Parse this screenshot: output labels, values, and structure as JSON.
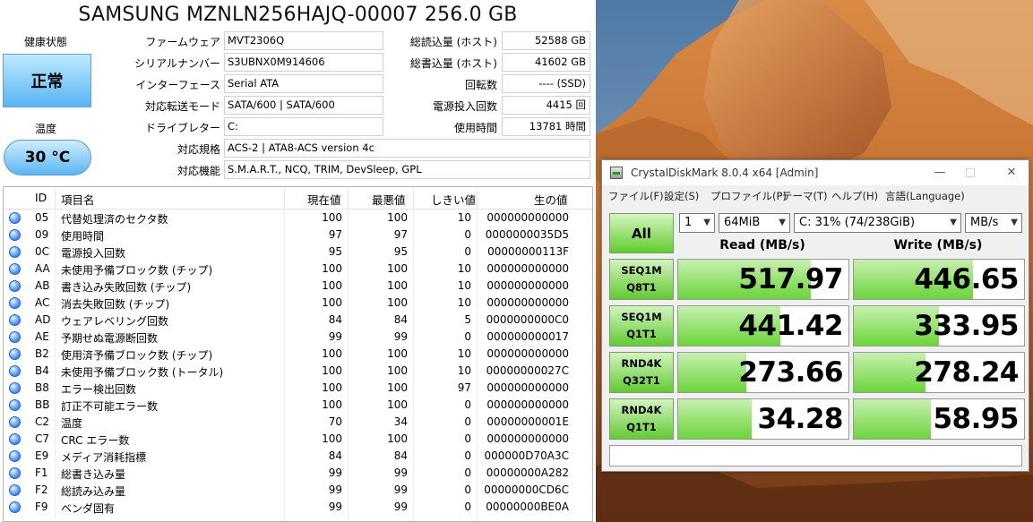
{
  "cdi": {
    "title": "SAMSUNG MZNLN256HAJQ-00007 256.0 GB",
    "health_label": "健康状態",
    "health_value": "正常",
    "temp_label": "温度",
    "temp_value": "30 °C",
    "info_left": [
      {
        "label": "ファームウェア",
        "value": "MVT2306Q"
      },
      {
        "label": "シリアルナンバー",
        "value": "S3UBNX0M914606"
      },
      {
        "label": "インターフェース",
        "value": "Serial ATA"
      },
      {
        "label": "対応転送モード",
        "value": "SATA/600 | SATA/600"
      },
      {
        "label": "ドライブレター",
        "value": "C:"
      }
    ],
    "info_right": [
      {
        "label": "総読込量 (ホスト)",
        "value": "52588 GB"
      },
      {
        "label": "総書込量 (ホスト)",
        "value": "41602 GB"
      },
      {
        "label": "回転数",
        "value": "---- (SSD)"
      },
      {
        "label": "電源投入回数",
        "value": "4415 回"
      },
      {
        "label": "使用時間",
        "value": "13781 時間"
      }
    ],
    "standard_label": "対応規格",
    "standard_value": "ACS-2 | ATA8-ACS version 4c",
    "features_label": "対応機能",
    "features_value": "S.M.A.R.T., NCQ, TRIM, DevSleep, GPL",
    "smart_headers": [
      "ID",
      "項目名",
      "現在値",
      "最悪値",
      "しきい値",
      "生の値"
    ],
    "smart_rows": [
      {
        "id": "05",
        "name": "代替処理済のセクタ数",
        "cur": "100",
        "worst": "100",
        "thr": "10",
        "raw": "000000000000"
      },
      {
        "id": "09",
        "name": "使用時間",
        "cur": "97",
        "worst": "97",
        "thr": "0",
        "raw": "0000000035D5"
      },
      {
        "id": "0C",
        "name": "電源投入回数",
        "cur": "95",
        "worst": "95",
        "thr": "0",
        "raw": "00000000113F"
      },
      {
        "id": "AA",
        "name": "未使用予備ブロック数 (チップ)",
        "cur": "100",
        "worst": "100",
        "thr": "10",
        "raw": "000000000000"
      },
      {
        "id": "AB",
        "name": "書き込み失敗回数 (チップ)",
        "cur": "100",
        "worst": "100",
        "thr": "10",
        "raw": "000000000000"
      },
      {
        "id": "AC",
        "name": "消去失敗回数 (チップ)",
        "cur": "100",
        "worst": "100",
        "thr": "10",
        "raw": "000000000000"
      },
      {
        "id": "AD",
        "name": "ウェアレベリング回数",
        "cur": "84",
        "worst": "84",
        "thr": "5",
        "raw": "0000000000C0"
      },
      {
        "id": "AE",
        "name": "予期せぬ電源断回数",
        "cur": "99",
        "worst": "99",
        "thr": "0",
        "raw": "000000000017"
      },
      {
        "id": "B2",
        "name": "使用済予備ブロック数 (チップ)",
        "cur": "100",
        "worst": "100",
        "thr": "10",
        "raw": "000000000000"
      },
      {
        "id": "B4",
        "name": "未使用予備ブロック数 (トータル)",
        "cur": "100",
        "worst": "100",
        "thr": "10",
        "raw": "00000000027C"
      },
      {
        "id": "B8",
        "name": "エラー検出回数",
        "cur": "100",
        "worst": "100",
        "thr": "97",
        "raw": "000000000000"
      },
      {
        "id": "BB",
        "name": "訂正不可能エラー数",
        "cur": "100",
        "worst": "100",
        "thr": "0",
        "raw": "000000000000"
      },
      {
        "id": "C2",
        "name": "温度",
        "cur": "70",
        "worst": "34",
        "thr": "0",
        "raw": "00000000001E"
      },
      {
        "id": "C7",
        "name": "CRC エラー数",
        "cur": "100",
        "worst": "100",
        "thr": "0",
        "raw": "000000000000"
      },
      {
        "id": "E9",
        "name": "メディア消耗指標",
        "cur": "84",
        "worst": "84",
        "thr": "0",
        "raw": "000000D70A3C"
      },
      {
        "id": "F1",
        "name": "総書き込み量",
        "cur": "99",
        "worst": "99",
        "thr": "0",
        "raw": "00000000A282"
      },
      {
        "id": "F2",
        "name": "総読み込み量",
        "cur": "99",
        "worst": "99",
        "thr": "0",
        "raw": "00000000CD6C"
      },
      {
        "id": "F9",
        "name": "ベンダ固有",
        "cur": "99",
        "worst": "99",
        "thr": "0",
        "raw": "00000000BE0A"
      }
    ],
    "status_color": "#2a6ee0"
  },
  "cdm": {
    "title": "CrystalDiskMark 8.0.4 x64 [Admin]",
    "menu": [
      "ファイル(F)",
      "設定(S)",
      "プロファイル(P)",
      "テーマ(T)",
      "ヘルプ(H)",
      "言語(Language)"
    ],
    "all_label": "All",
    "count": "1",
    "size": "64MiB",
    "drive": "C: 31% (74/238GiB)",
    "unit": "MB/s",
    "read_header": "Read (MB/s)",
    "write_header": "Write (MB/s)",
    "tests": [
      {
        "l1": "SEQ1M",
        "l2": "Q8T1",
        "read": "517.97",
        "write": "446.65",
        "read_level": 0.78,
        "write_level": 0.7
      },
      {
        "l1": "SEQ1M",
        "l2": "Q1T1",
        "read": "441.42",
        "write": "333.95",
        "read_level": 0.6,
        "write_level": 0.5
      },
      {
        "l1": "RND4K",
        "l2": "Q32T1",
        "read": "273.66",
        "write": "278.24",
        "read_level": 0.4,
        "write_level": 0.42
      },
      {
        "l1": "RND4K",
        "l2": "Q1T1",
        "read": "34.28",
        "write": "58.95",
        "read_level": 0.43,
        "write_level": 0.45
      }
    ],
    "accent": "#5fcd2e"
  }
}
